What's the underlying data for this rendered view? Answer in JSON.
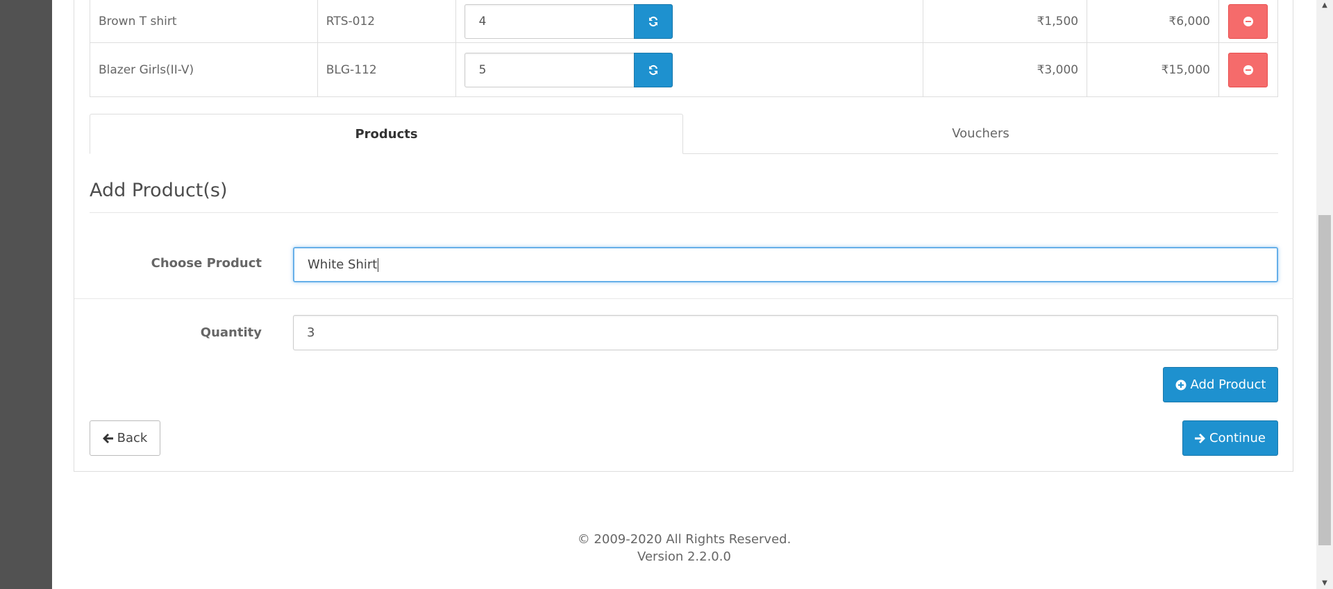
{
  "cart": {
    "rows": [
      {
        "name": "Brown T shirt",
        "model": "RTS-012",
        "quantity": "4",
        "unit_price": "₹1,500",
        "total": "₹6,000"
      },
      {
        "name": "Blazer Girls(II-V)",
        "model": "BLG-112",
        "quantity": "5",
        "unit_price": "₹3,000",
        "total": "₹15,000"
      }
    ]
  },
  "tabs": [
    {
      "label": "Products",
      "active": true
    },
    {
      "label": "Vouchers",
      "active": false
    }
  ],
  "add_product": {
    "legend": "Add Product(s)",
    "choose_product_label": "Choose Product",
    "choose_product_value": "White Shirt",
    "quantity_label": "Quantity",
    "quantity_value": "3",
    "add_button_label": "Add Product"
  },
  "nav": {
    "back_label": "Back",
    "continue_label": "Continue"
  },
  "footer": {
    "copyright": "© 2009-2020 All Rights Reserved.",
    "version": "Version 2.2.0.0"
  },
  "colors": {
    "primary": "#1e91cf",
    "danger": "#f56b6b",
    "sidebar": "#525252",
    "focus": "#66afe9"
  },
  "icons": {
    "refresh": "refresh-icon",
    "remove": "minus-circle-icon",
    "add": "plus-circle-icon",
    "back": "arrow-left-icon",
    "continue": "arrow-right-icon"
  }
}
